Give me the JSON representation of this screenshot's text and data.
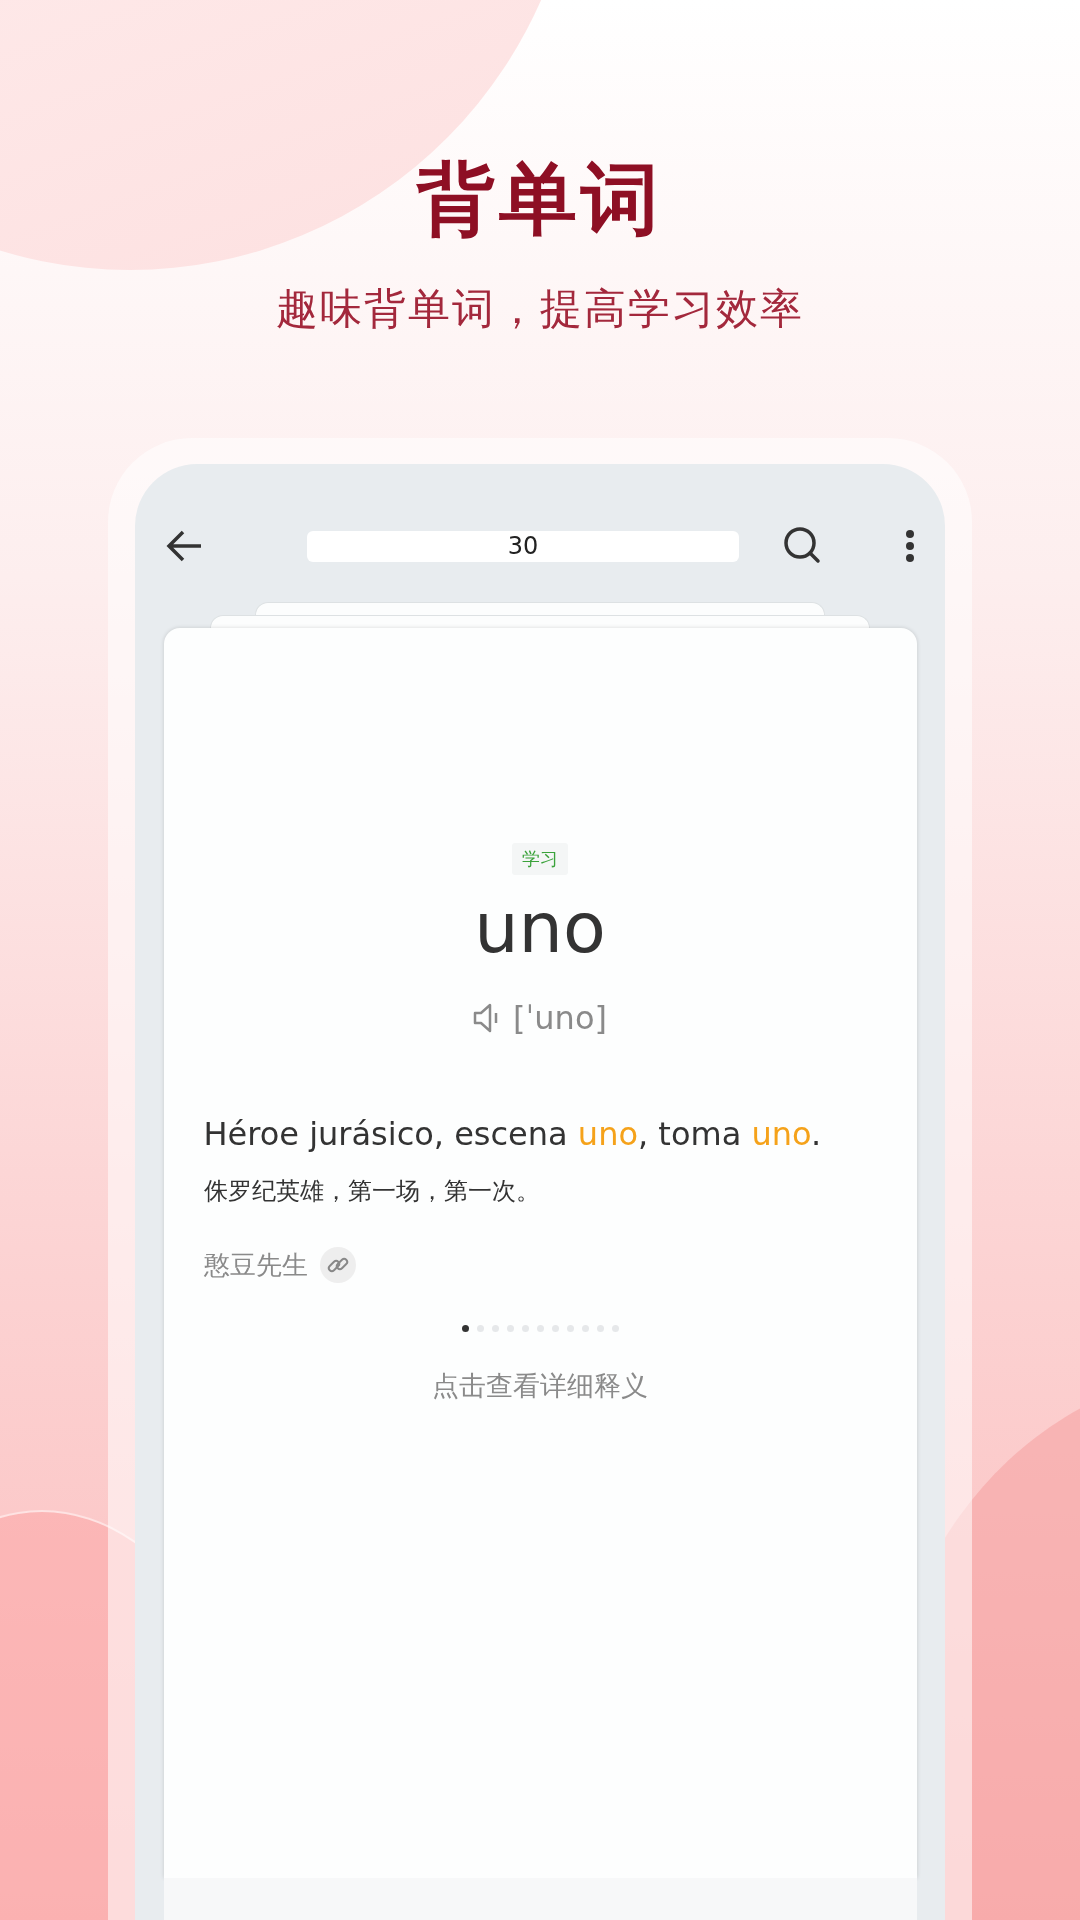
{
  "headline": {
    "title": "背单词",
    "subtitle": "趣味背单词，提高学习效率"
  },
  "toolbar": {
    "counter": "30"
  },
  "card": {
    "tag": "学习",
    "word": "uno",
    "phonetic": "[ˈuno]",
    "sentence": [
      {
        "text": "Héroe jurásico, escena ",
        "highlight": false
      },
      {
        "text": "uno",
        "highlight": true
      },
      {
        "text": ", toma ",
        "highlight": false
      },
      {
        "text": "uno",
        "highlight": true
      },
      {
        "text": ".",
        "highlight": false
      }
    ],
    "translation": "侏罗纪英雄，第一场，第一次。",
    "source": "憨豆先生",
    "page_dots": [
      {
        "selected": true
      },
      {
        "selected": false
      },
      {
        "selected": false
      },
      {
        "selected": false
      },
      {
        "selected": false
      },
      {
        "selected": false
      },
      {
        "selected": false
      },
      {
        "selected": false
      },
      {
        "selected": false
      },
      {
        "selected": false
      },
      {
        "selected": false
      }
    ],
    "detail_link": "点击查看详细释义"
  }
}
